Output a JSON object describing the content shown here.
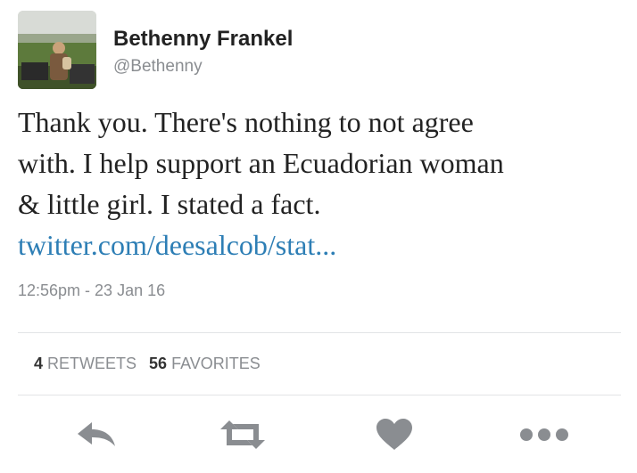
{
  "tweet": {
    "author": {
      "display_name": "Bethenny Frankel",
      "handle": "@Bethenny"
    },
    "text_lines": [
      "Thank you. There's nothing to not agree",
      "with. I help support an Ecuadorian woman",
      "& little girl. I stated a fact."
    ],
    "link": "twitter.com/deesalcob/stat...",
    "timestamp": "12:56pm - 23 Jan 16",
    "stats": {
      "retweets_count": "4",
      "retweets_label": "RETWEETS",
      "favorites_count": "56",
      "favorites_label": "FAVORITES"
    }
  },
  "actions": [
    {
      "name": "reply",
      "icon": "reply-icon"
    },
    {
      "name": "retweet",
      "icon": "retweet-icon"
    },
    {
      "name": "favorite",
      "icon": "heart-icon"
    },
    {
      "name": "more",
      "icon": "more-icon"
    }
  ],
  "colors": {
    "text": "#222222",
    "muted": "#8a8d91",
    "link": "#2d7eb5",
    "icon": "#8a8d91",
    "divider": "#e2e4e6"
  }
}
